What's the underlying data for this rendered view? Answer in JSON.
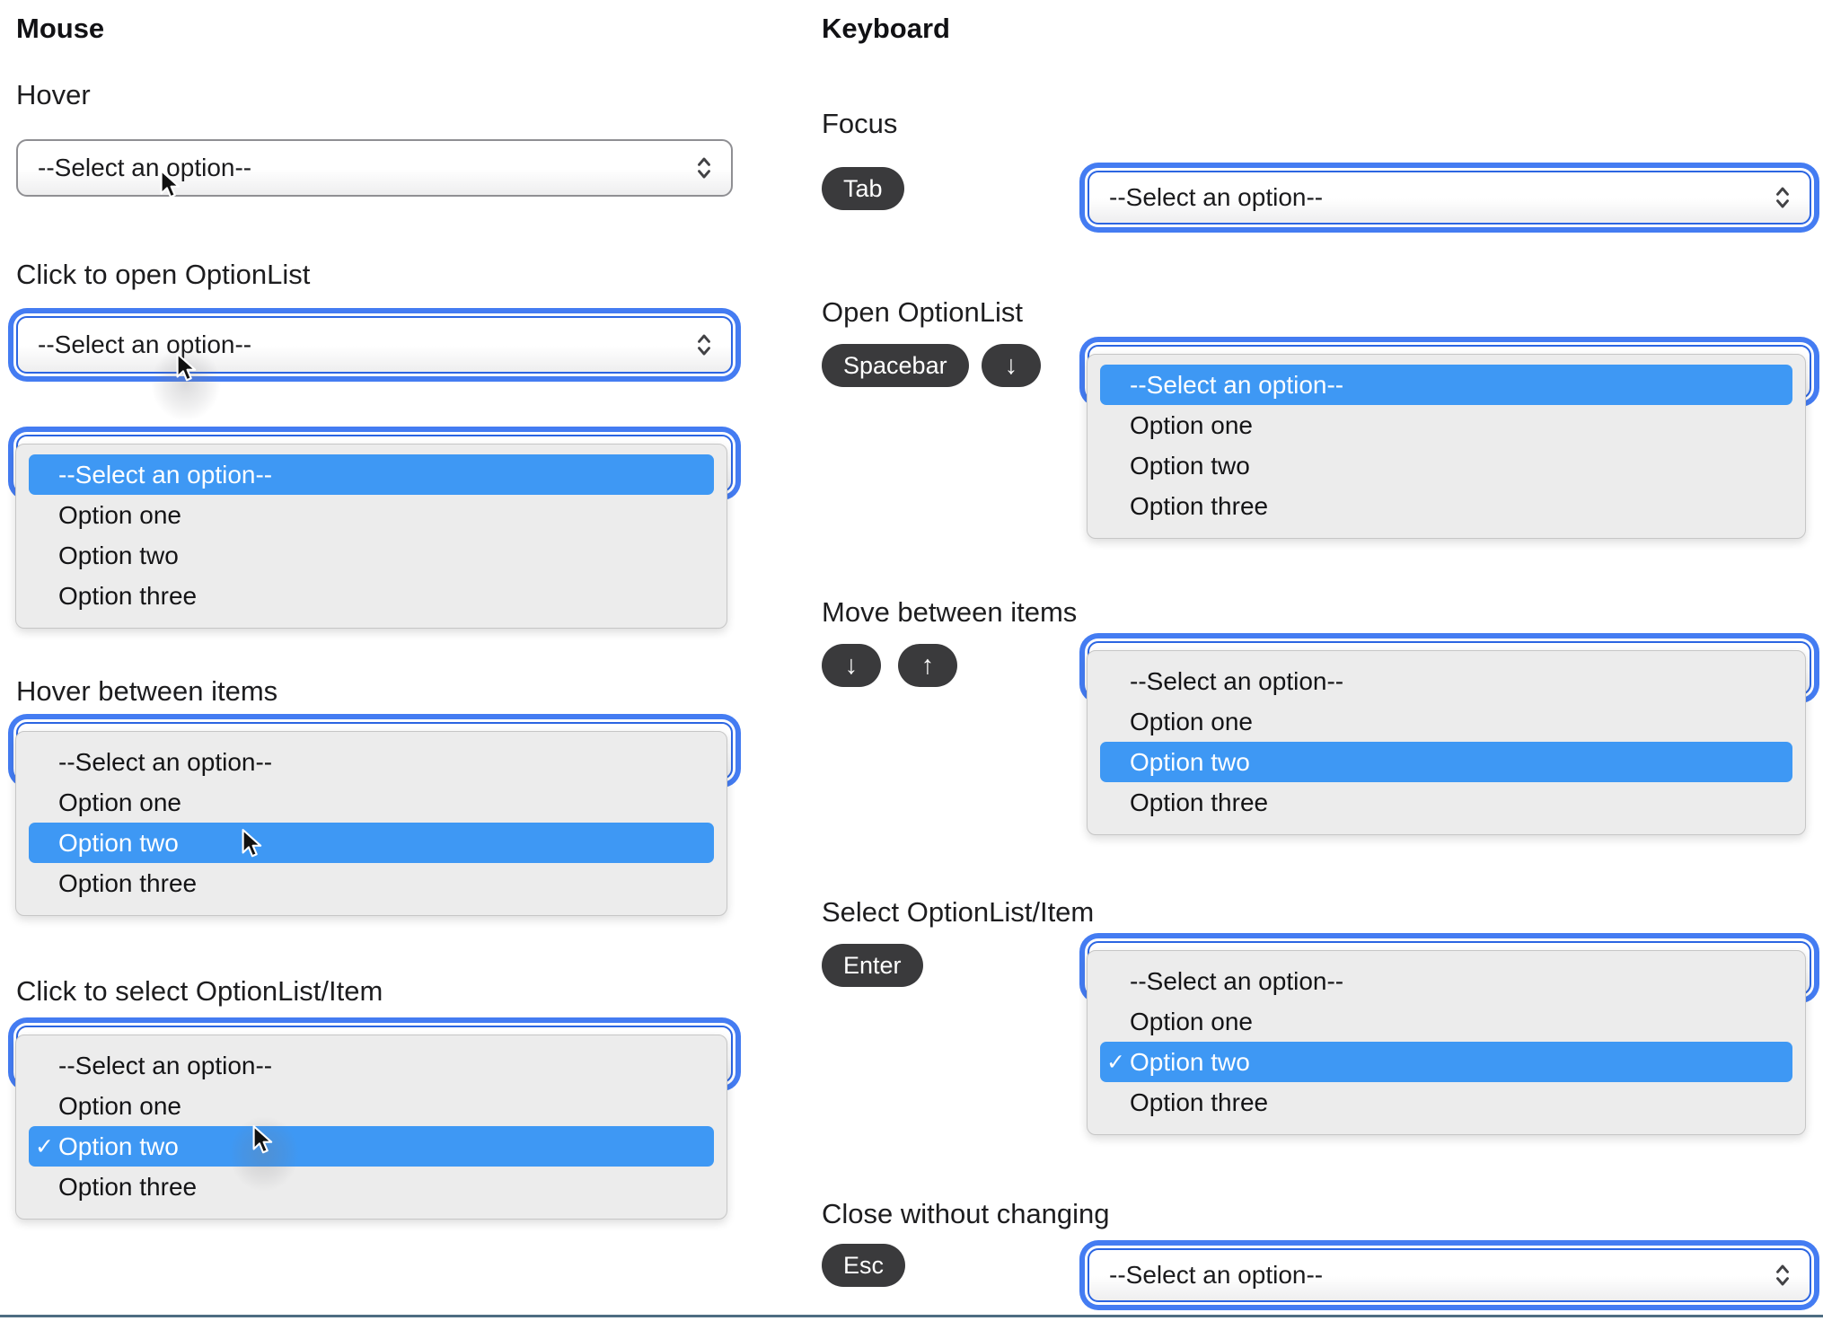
{
  "colors": {
    "highlight_blue": "#3E98F4",
    "focus_ring_blue": "#447CF2",
    "focus_border_blue": "#2B65E2",
    "pill_bg": "#3A3A3C",
    "panel_bg": "#ECECEC",
    "select_border": "#8F8F93",
    "bottom_divider": "#4E6D82"
  },
  "select": {
    "placeholder": "--Select an option--",
    "chevron_icon": "chevron-up-down-icon"
  },
  "mouse": {
    "title": "Mouse",
    "sections": {
      "hover": {
        "label": "Hover"
      },
      "click_open": {
        "label": "Click to open OptionList"
      },
      "hover_items": {
        "label": "Hover between items"
      },
      "click_select": {
        "label": "Click to select OptionList/Item"
      }
    }
  },
  "keyboard": {
    "title": "Keyboard",
    "sections": {
      "focus": {
        "label": "Focus",
        "keys": [
          "Tab"
        ]
      },
      "open": {
        "label": "Open OptionList",
        "keys": [
          "Spacebar",
          "↓"
        ]
      },
      "move": {
        "label": "Move between items",
        "keys": [
          "↓",
          "↑"
        ]
      },
      "select_item": {
        "label": "Select OptionList/Item",
        "keys": [
          "Enter"
        ]
      },
      "close": {
        "label": "Close without changing",
        "keys": [
          "Esc"
        ]
      }
    }
  },
  "option_lists": {
    "placeholder_highlighted": {
      "highlight": 0,
      "checked": -1,
      "options": [
        "--Select an option--",
        "Option one",
        "Option two",
        "Option three"
      ]
    },
    "option_two_highlighted": {
      "highlight": 2,
      "checked": -1,
      "options": [
        "--Select an option--",
        "Option one",
        "Option two",
        "Option three"
      ]
    },
    "option_two_selected": {
      "highlight": 2,
      "checked": 2,
      "options": [
        "--Select an option--",
        "Option one",
        "Option two",
        "Option three"
      ]
    }
  }
}
